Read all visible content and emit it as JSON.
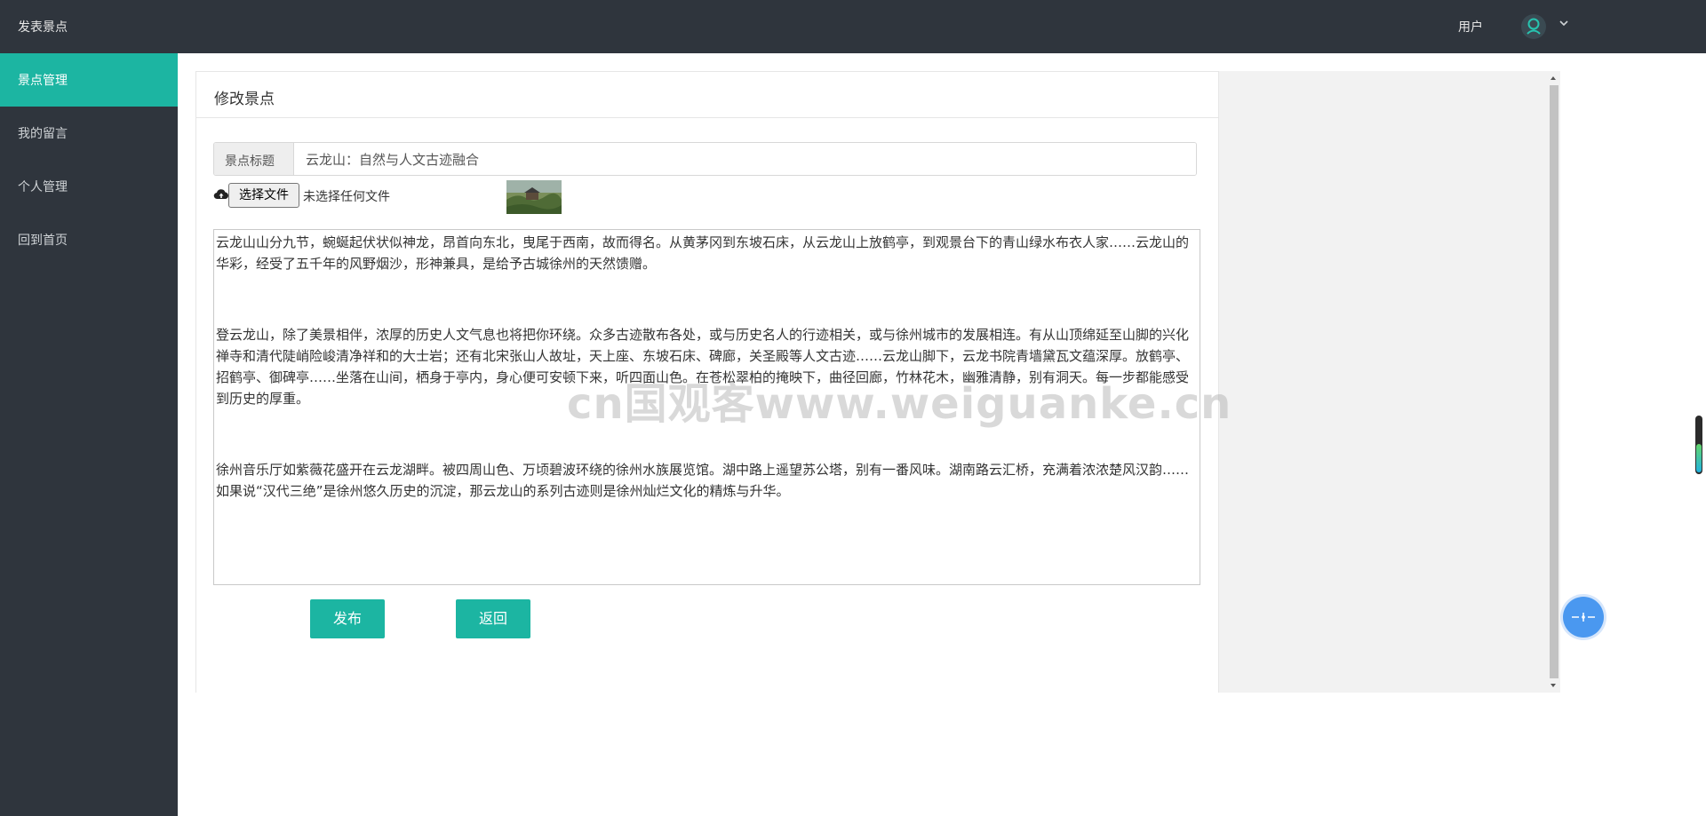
{
  "topbar": {
    "title": "发表景点",
    "user_label": "用户"
  },
  "sidebar": {
    "items": [
      {
        "label": "景点管理",
        "active": true
      },
      {
        "label": "我的留言",
        "active": false
      },
      {
        "label": "个人管理",
        "active": false
      },
      {
        "label": "回到首页",
        "active": false
      }
    ]
  },
  "panel": {
    "title": "修改景点"
  },
  "form": {
    "title_label": "景点标题",
    "title_value": "云龙山：自然与人文古迹融合",
    "file_button": "选择文件",
    "file_status": "未选择任何文件",
    "content": {
      "p1": " 云龙山山分九节，蜿蜒起伏状似神龙，昂首向东北，曳尾于西南，故而得名。从黄茅冈到东坡石床，从云龙山上放鹤亭，到观景台下的青山绿水布衣人家……云龙山的华彩，经受了五千年的风野烟沙，形神兼具，是给予古城徐州的天然馈赠。",
      "p2": " 登云龙山，除了美景相伴，浓厚的历史人文气息也将把你环绕。众多古迹散布各处，或与历史名人的行迹相关，或与徐州城市的发展相连。有从山顶绵延至山脚的兴化禅寺和清代陡峭险峻清净祥和的大士岩；还有北宋张山人故址，天上座、东坡石床、碑廊，关圣殿等人文古迹……云龙山脚下，云龙书院青墙黛瓦文蕴深厚。放鹤亭、招鹤亭、御碑亭……坐落在山间，栖身于亭内，身心便可安顿下来，听四面山色。在苍松翠柏的掩映下，曲径回廊，竹林花木，幽雅清静，别有洞天。每一步都能感受到历史的厚重。",
      "p3": " 徐州音乐厅如紫薇花盛开在云龙湖畔。被四周山色、万顷碧波环绕的徐州水族展览馆。湖中路上遥望苏公塔，别有一番风味。湖南路云汇桥，充满着浓浓楚风汉韵……如果说“汉代三绝”是徐州悠久历史的沉淀，那云龙山的系列古迹则是徐州灿烂文化的精炼与升华。"
    },
    "publish_button": "发布",
    "back_button": "返回"
  },
  "watermark": "cn国观客www.weiguanke.cn",
  "colors": {
    "topbar": "#2f353d",
    "accent": "#1cb5a2"
  }
}
